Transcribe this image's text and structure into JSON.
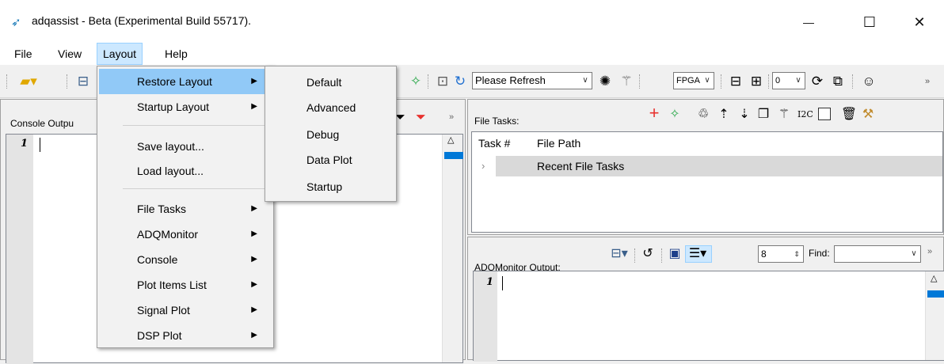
{
  "window": {
    "title": "adqassist - Beta (Experimental Build 55717).",
    "minimize_glyph": "—",
    "maximize_glyph": "☐",
    "close_glyph": "✕"
  },
  "menubar": [
    "File",
    "View",
    "Layout",
    "Help"
  ],
  "toolbar": {
    "refresh_combo": "Please Refresh",
    "fpga_combo": "FPGA",
    "number_combo": "0"
  },
  "layout_menu": {
    "items": [
      {
        "label": "Restore Layout",
        "submenu": true
      },
      {
        "label": "Startup Layout",
        "submenu": true
      },
      {
        "label": "Save layout...",
        "submenu": false
      },
      {
        "label": "Load layout...",
        "submenu": false
      },
      {
        "label": "File Tasks",
        "submenu": true
      },
      {
        "label": "ADQMonitor",
        "submenu": true
      },
      {
        "label": "Console",
        "submenu": true
      },
      {
        "label": "Plot Items List",
        "submenu": true
      },
      {
        "label": "Signal Plot",
        "submenu": true
      },
      {
        "label": "DSP Plot",
        "submenu": true
      }
    ],
    "restore_submenu": [
      "Default",
      "Advanced",
      "Debug",
      "Data Plot",
      "Startup"
    ]
  },
  "console": {
    "label": "Console Outpu",
    "line_number": "1"
  },
  "file_tasks": {
    "label": "File Tasks:",
    "i2c_label": "I2C",
    "columns": [
      "Task #",
      "File Path"
    ],
    "rows": [
      "Recent File Tasks"
    ]
  },
  "adq_monitor": {
    "label": "ADQMonitor Output:",
    "number_field": "8",
    "find_label": "Find:",
    "line_number": "1"
  },
  "colors": {
    "menu_highlight": "#cce8ff",
    "selected_item": "#91c9f7",
    "accent": "#0078d7",
    "add_red": "#e8312e"
  }
}
